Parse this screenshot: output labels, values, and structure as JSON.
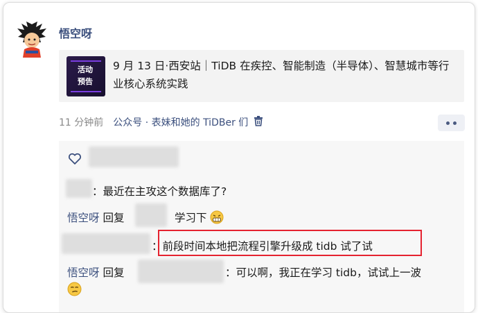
{
  "post": {
    "author": "悟空呀",
    "card_thumb_text": "活动\n预告",
    "card_title": "9 月 13 日·西安站｜TiDB 在疾控、智能制造（半导体）、智慧城市等行业核心系统实践",
    "time": "11 分钟前",
    "source": "公众号 · 表妹和她的 TiDBer 们"
  },
  "comments": [
    {
      "user": "",
      "text": "：最近在主攻这个数据库了?"
    },
    {
      "user": "悟空呀",
      "reply_word": "回复",
      "reply_to": "",
      "text": "学习下",
      "emoji": "grin-emoji"
    },
    {
      "user": "",
      "text": "：前段时间本地把流程引擎升级成 tidb 试了试"
    },
    {
      "user": "悟空呀",
      "reply_word": "回复",
      "reply_to": "",
      "text": "：可以啊，我正在学习 tidb，试试上一波",
      "emoji": "smirk-emoji"
    }
  ],
  "colors": {
    "name": "#3b4f7d",
    "highlight": "#e5222f"
  }
}
